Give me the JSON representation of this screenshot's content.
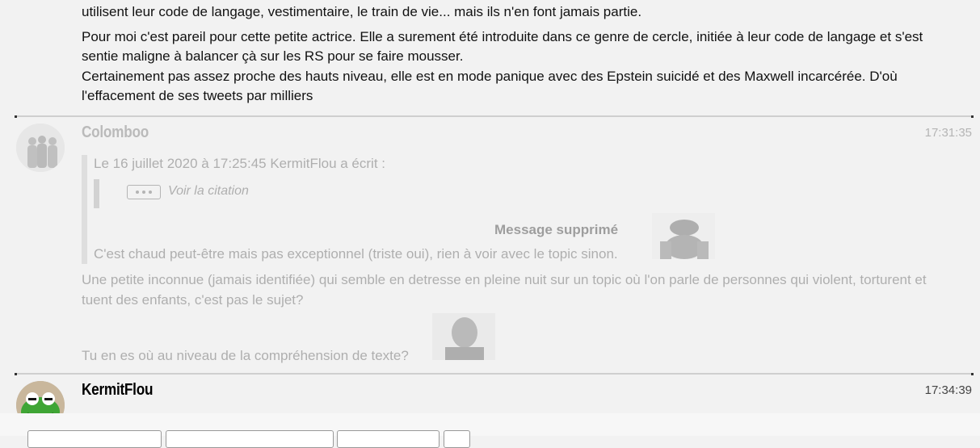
{
  "post1": {
    "line0": "utilisent leur code de langage, vestimentaire, le train de vie... mais ils n'en font jamais partie.",
    "para1": "Pour moi c'est pareil pour cette petite actrice. Elle a surement été introduite dans ce genre de cercle, initiée à leur code de langage et s'est sentie maligne à balancer çà sur les RS pour se faire mousser.",
    "para2": "Certainement pas assez proche des hauts niveau, elle est en mode panique avec des Epstein suicidé et des Maxwell incarcérée. D'où l'effacement de ses tweets par milliers"
  },
  "post2": {
    "author": "Colomboo",
    "time": "17:31:35",
    "quote_header": "Le 16 juillet 2020 à 17:25:45 KermitFlou a écrit :",
    "view_quote": "Voir la citation",
    "deleted_message": "Message supprimé",
    "quote_text": "C'est chaud peut-être mais pas exceptionnel (triste oui), rien à voir avec le topic sinon.",
    "body1": "Une petite inconnue (jamais identifiée) qui semble en detresse en pleine nuit sur un topic où l'on parle de personnes qui violent, torturent et tuent des enfants, c'est pas le sujet?",
    "body2": "Tu en es où au niveau de la compréhension de texte?"
  },
  "post3": {
    "author": "KermitFlou",
    "time": "17:34:39"
  },
  "icons": {
    "ellipsis": "ellipsis-icon"
  }
}
